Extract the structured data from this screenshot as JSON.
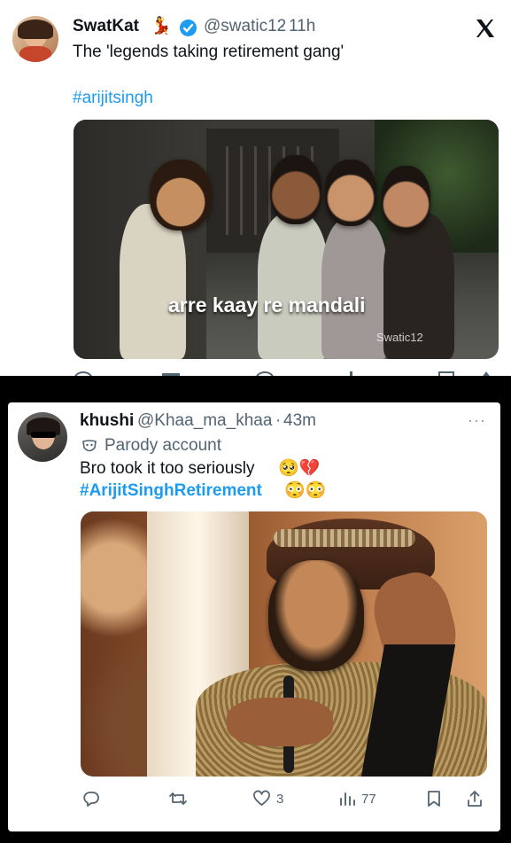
{
  "tweet1": {
    "display_name": "SwatKat",
    "name_emoji": "💃",
    "handle": "@swatic12",
    "separator": "·",
    "time": "11h",
    "text": "The 'legends taking retirement gang'",
    "hashtag": "#arijitsingh",
    "media": {
      "caption": "arre kaay re mandali",
      "watermark": "Swatic12"
    },
    "icons": {
      "logo": "x-logo-icon",
      "verified": "verified-badge-icon"
    }
  },
  "tweet2": {
    "display_name": "khushi",
    "handle": "@Khaa_ma_khaa",
    "separator": "·",
    "time": "43m",
    "parody_label": "Parody account",
    "text": "Bro took it too seriously",
    "text_emojis": "🥺💔",
    "hashtag": "#ArijitSinghRetirement",
    "hashtag_emojis": "😳😳",
    "more": "···",
    "actions": {
      "reply": "",
      "retweet": "",
      "like": "3",
      "views": "77"
    }
  },
  "colors": {
    "accent": "#1d9bf0",
    "text": "#0f1419",
    "muted": "#536471",
    "background": "#000000"
  }
}
